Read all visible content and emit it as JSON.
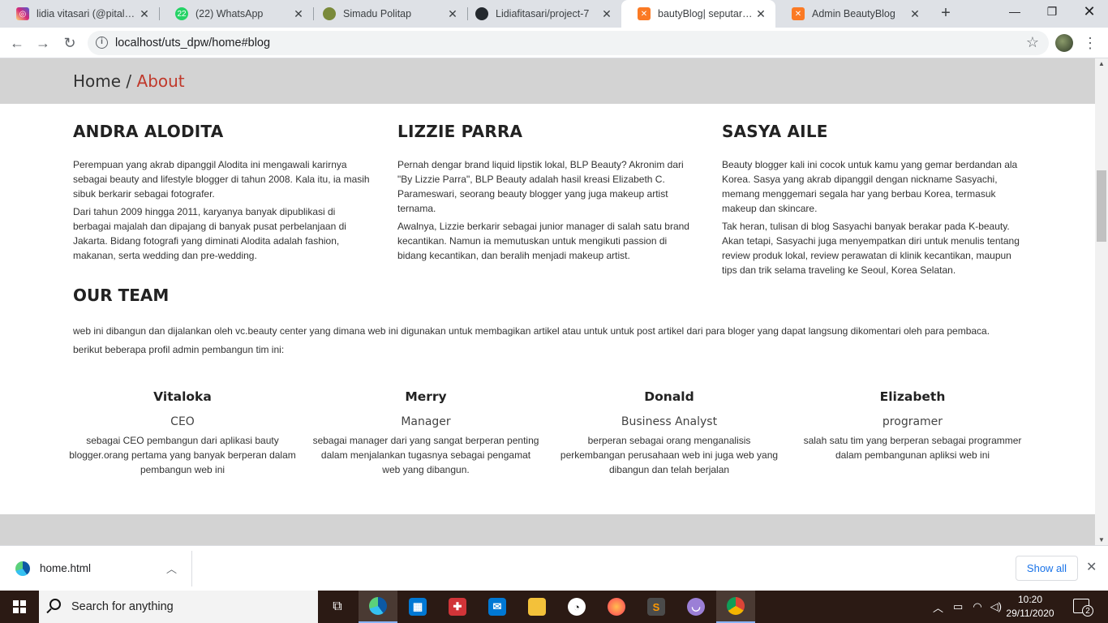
{
  "browser": {
    "tabs": [
      {
        "title": "lidia vitasari (@pitaloka",
        "icon": "instagram-icon",
        "color": "#d62976"
      },
      {
        "title": "(22) WhatsApp",
        "icon": "whatsapp-icon",
        "badge": "22",
        "color": "#25d366"
      },
      {
        "title": "Simadu Politap",
        "icon": "politap-icon",
        "color": "#7a8a3a"
      },
      {
        "title": "Lidiafitasari/project-7",
        "icon": "github-icon",
        "color": "#24292e"
      },
      {
        "title": "bautyBlog| seputar dun",
        "icon": "xampp-icon",
        "color": "#fb7a24"
      },
      {
        "title": "Admin BeautyBlog",
        "icon": "xampp-icon",
        "color": "#fb7a24"
      }
    ],
    "url": "localhost/uts_dpw/home#blog"
  },
  "breadcrumb": {
    "home": "Home",
    "separator": " / ",
    "current": "About"
  },
  "bloggers": [
    {
      "name": "ANDRA ALODITA",
      "paragraphs": [
        "Perempuan yang akrab dipanggil Alodita ini mengawali karirnya sebagai beauty and lifestyle blogger di tahun 2008. Kala itu, ia masih sibuk berkarir sebagai fotografer.",
        "Dari tahun 2009 hingga 2011, karyanya banyak dipublikasi di berbagai majalah dan dipajang di banyak pusat perbelanjaan di Jakarta. Bidang fotografi yang diminati Alodita adalah fashion, makanan, serta wedding dan pre-wedding."
      ]
    },
    {
      "name": "LIZZIE PARRA",
      "paragraphs": [
        "Pernah dengar brand liquid lipstik lokal, BLP Beauty? Akronim dari \"By Lizzie Parra\", BLP Beauty adalah hasil kreasi Elizabeth C. Parameswari, seorang beauty blogger yang juga makeup artist ternama.",
        "Awalnya, Lizzie berkarir sebagai junior manager di salah satu brand kecantikan. Namun ia memutuskan untuk mengikuti passion di bidang kecantikan, dan beralih menjadi makeup artist."
      ]
    },
    {
      "name": "SASYA AILE",
      "paragraphs": [
        "Beauty blogger kali ini cocok untuk kamu yang gemar berdandan ala Korea. Sasya yang akrab dipanggil dengan nickname Sasyachi, memang menggemari segala har yang berbau Korea, termasuk makeup dan skincare.",
        "Tak heran, tulisan di blog Sasyachi banyak berakar pada K-beauty. Akan tetapi, Sasyachi juga menyempatkan diri untuk menulis tentang review produk lokal, review perawatan di klinik kecantikan, maupun tips dan trik selama traveling ke Seoul, Korea Selatan."
      ]
    }
  ],
  "team": {
    "title": "OUR TEAM",
    "description_1": "web ini dibangun dan dijalankan oleh vc.beauty center yang dimana web ini digunakan untuk membagikan artikel atau untuk untuk post artikel dari para bloger yang dapat langsung dikomentari oleh para pembaca.",
    "description_2": "berikut beberapa profil admin pembangun tim ini:",
    "members": [
      {
        "name": "Vitaloka",
        "role": "CEO",
        "desc": "sebagai CEO pembangun dari aplikasi bauty blogger.orang pertama yang banyak berperan dalam pembangun web ini"
      },
      {
        "name": "Merry",
        "role": "Manager",
        "desc": "sebagai manager dari yang sangat berperan penting dalam menjalankan tugasnya sebagai pengamat web yang dibangun."
      },
      {
        "name": "Donald",
        "role": "Business Analyst",
        "desc": "berperan sebagai orang menganalisis perkembangan perusahaan web ini juga web yang dibangun dan telah berjalan"
      },
      {
        "name": "Elizabeth",
        "role": "programer",
        "desc": "salah satu tim yang berperan sebagai programmer dalam pembangunan apliksi web ini"
      }
    ]
  },
  "downloads": {
    "file": "home.html",
    "show_all": "Show all"
  },
  "taskbar": {
    "search_placeholder": "Search for anything",
    "time": "10:20",
    "date": "29/11/2020",
    "notification_count": "2"
  }
}
